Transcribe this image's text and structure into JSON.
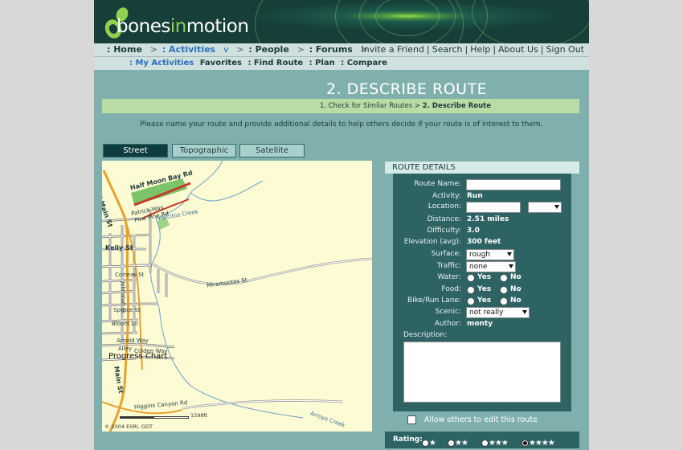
{
  "brand": {
    "logo_prefix": "bones",
    "logo_mid": "in",
    "logo_suffix": "motion",
    "accent": "#8fd14f"
  },
  "nav_primary": {
    "items": [
      {
        "label": ": Home"
      },
      {
        "label": ": Activities"
      },
      {
        "label": ": People"
      },
      {
        "label": ": Forums"
      }
    ],
    "activities_dropdown": "v",
    "separator": ">",
    "utility_links": [
      "Invite a Friend",
      "Search",
      "Help",
      "About Us",
      "Sign Out"
    ]
  },
  "nav_secondary": {
    "items": [
      ": My Activities",
      "Favorites",
      ": Find Route",
      ": Plan",
      ": Compare"
    ]
  },
  "page": {
    "title": "2. DESCRIBE ROUTE",
    "steps": {
      "step1": "1. Check for Similar Routes",
      "sep": ">",
      "step2": "2. Describe Route"
    },
    "intro": "Please name your route and provide additional details to help others decide if your route is of interest to them."
  },
  "map": {
    "tabs": [
      "Street",
      "Topographic",
      "Satellite"
    ],
    "active_tab": "Street",
    "labels": {
      "half_moon": "Half Moon Bay Rd",
      "n_main": "N Main St",
      "patrick": "Patrick Way",
      "pine": "Pine Pine Rd",
      "pilarcitos": "Pilarcitos Creek",
      "kelly": "Kelly St",
      "correas": "Correas St",
      "johnston": "Johnston St",
      "miramontes": "Miramontes St",
      "spruce": "Spruce St",
      "bloom": "Bloom Ln",
      "arnold": "Arnold Way",
      "alley": "Alley",
      "colden": "Colden Way",
      "main": "Main St",
      "higgins": "Higgins Canyon Rd",
      "arroyo": "Arroyo Creek"
    },
    "landmark": "Progress Chart",
    "scale": "1598ft",
    "copyright": "© 2004 ESRI, GDT"
  },
  "details": {
    "header": "ROUTE DETAILS",
    "route_name": {
      "label": "Route Name:",
      "value": ""
    },
    "activity": {
      "label": "Activity:",
      "value": "Run"
    },
    "location": {
      "label": "Location:",
      "value": "",
      "select": ""
    },
    "distance": {
      "label": "Distance:",
      "value": "2.51 miles"
    },
    "difficulty": {
      "label": "Difficulty:",
      "value": "3.0"
    },
    "elevation": {
      "label": "Elevation (avg):",
      "value": "300 feet"
    },
    "surface": {
      "label": "Surface:",
      "value": "rough"
    },
    "traffic": {
      "label": "Traffic:",
      "value": "none"
    },
    "water": {
      "label": "Water:",
      "yes": "Yes",
      "no": "No"
    },
    "food": {
      "label": "Food:",
      "yes": "Yes",
      "no": "No"
    },
    "bike_lane": {
      "label": "Bike/Run Lane:",
      "yes": "Yes",
      "no": "No"
    },
    "scenic": {
      "label": "Scenic:",
      "value": "not really"
    },
    "author": {
      "label": "Author:",
      "value": "monty"
    },
    "description": {
      "label": "Description:",
      "value": ""
    }
  },
  "allow_edit": {
    "label": "Allow others to edit this route",
    "checked": false
  },
  "rating": {
    "label": "Rating:",
    "options": [
      "★",
      "★★",
      "★★★",
      "★★★★"
    ],
    "selected_index": 3
  }
}
